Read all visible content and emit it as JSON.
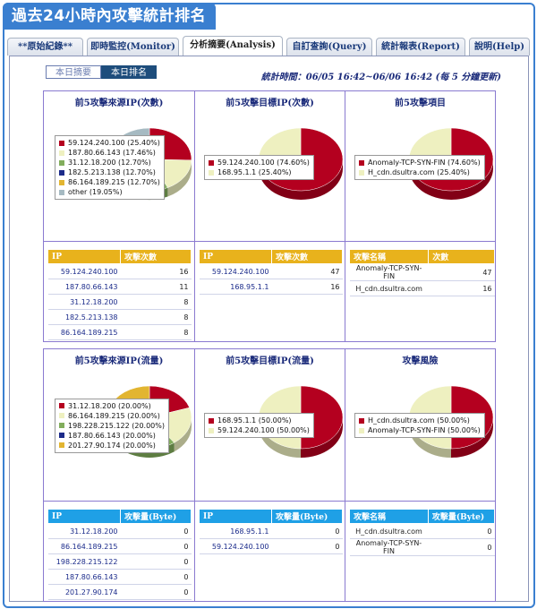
{
  "header": {
    "title": "過去24小時內攻擊統計排名"
  },
  "tabs": [
    {
      "label": "**原始紀錄**"
    },
    {
      "label": "即時監控(Monitor)"
    },
    {
      "label": "分析摘要(Analysis)"
    },
    {
      "label": "自訂查詢(Query)"
    },
    {
      "label": "統計報表(Report)"
    },
    {
      "label": "說明(Help)"
    }
  ],
  "subtabs": [
    {
      "label": "本日摘要"
    },
    {
      "label": "本日排名"
    }
  ],
  "stat_time": "統計時間：06/05 16:42~06/06 16:42 (每 5 分鐘更新)",
  "colors": {
    "red": "#b4001f",
    "cream": "#eef0c0",
    "green": "#82ad5c",
    "navy": "#1c2b8a",
    "gold": "#e2b531",
    "gray": "#a6bac2",
    "tab_blue": "#3a7fd0"
  },
  "chart_data": [
    {
      "type": "pie",
      "title": "前5攻擊來源IP(次數)",
      "labels": [
        "59.124.240.100",
        "187.80.66.143",
        "31.12.18.200",
        "182.5.213.138",
        "86.164.189.215",
        "other"
      ],
      "values": [
        25.4,
        17.46,
        12.7,
        12.7,
        12.7,
        19.05
      ],
      "legend": [
        "59.124.240.100 (25.40%)",
        "187.80.66.143 (17.46%)",
        "31.12.18.200 (12.70%)",
        "182.5.213.138 (12.70%)",
        "86.164.189.215 (12.70%)",
        "other (19.05%)"
      ],
      "colors": [
        "#b4001f",
        "#eef0c0",
        "#82ad5c",
        "#1c2b8a",
        "#e2b531",
        "#a6bac2"
      ]
    },
    {
      "type": "pie",
      "title": "前5攻擊目標IP(次數)",
      "labels": [
        "59.124.240.100",
        "168.95.1.1"
      ],
      "values": [
        74.6,
        25.4
      ],
      "legend": [
        "59.124.240.100 (74.60%)",
        "168.95.1.1 (25.40%)"
      ],
      "colors": [
        "#b4001f",
        "#eef0c0"
      ]
    },
    {
      "type": "pie",
      "title": "前5攻擊項目",
      "labels": [
        "Anomaly-TCP-SYN-FIN",
        "H_cdn.dsultra.com"
      ],
      "values": [
        74.6,
        25.4
      ],
      "legend": [
        "Anomaly-TCP-SYN-FIN (74.60%)",
        "H_cdn.dsultra.com (25.40%)"
      ],
      "colors": [
        "#b4001f",
        "#eef0c0"
      ]
    },
    {
      "type": "pie",
      "title": "前5攻擊來源IP(流量)",
      "labels": [
        "31.12.18.200",
        "86.164.189.215",
        "198.228.215.122",
        "187.80.66.143",
        "201.27.90.174"
      ],
      "values": [
        20.0,
        20.0,
        20.0,
        20.0,
        20.0
      ],
      "legend": [
        "31.12.18.200 (20.00%)",
        "86.164.189.215 (20.00%)",
        "198.228.215.122 (20.00%)",
        "187.80.66.143 (20.00%)",
        "201.27.90.174 (20.00%)"
      ],
      "colors": [
        "#b4001f",
        "#eef0c0",
        "#82ad5c",
        "#1c2b8a",
        "#e2b531"
      ]
    },
    {
      "type": "pie",
      "title": "前5攻擊目標IP(流量)",
      "labels": [
        "168.95.1.1",
        "59.124.240.100"
      ],
      "values": [
        50.0,
        50.0
      ],
      "legend": [
        "168.95.1.1 (50.00%)",
        "59.124.240.100 (50.00%)"
      ],
      "colors": [
        "#b4001f",
        "#eef0c0"
      ]
    },
    {
      "type": "pie",
      "title": "攻擊風險",
      "labels": [
        "H_cdn.dsultra.com",
        "Anomaly-TCP-SYN-FIN"
      ],
      "values": [
        50.0,
        50.0
      ],
      "legend": [
        "H_cdn.dsultra.com (50.00%)",
        "Anomaly-TCP-SYN-FIN (50.00%)"
      ],
      "colors": [
        "#b4001f",
        "#eef0c0"
      ]
    }
  ],
  "tables": [
    {
      "headers": [
        "IP",
        "攻擊次數"
      ],
      "rows": [
        [
          "59.124.240.100",
          "16"
        ],
        [
          "187.80.66.143",
          "11"
        ],
        [
          "31.12.18.200",
          "8"
        ],
        [
          "182.5.213.138",
          "8"
        ],
        [
          "86.164.189.215",
          "8"
        ]
      ]
    },
    {
      "headers": [
        "IP",
        "攻擊次數"
      ],
      "rows": [
        [
          "59.124.240.100",
          "47"
        ],
        [
          "168.95.1.1",
          "16"
        ]
      ]
    },
    {
      "headers": [
        "攻擊名稱",
        "次數"
      ],
      "rows": [
        [
          "Anomaly-TCP-SYN-FIN",
          "47"
        ],
        [
          "H_cdn.dsultra.com",
          "16"
        ]
      ]
    },
    {
      "headers": [
        "IP",
        "攻擊量(Byte)"
      ],
      "rows": [
        [
          "31.12.18.200",
          "0"
        ],
        [
          "86.164.189.215",
          "0"
        ],
        [
          "198.228.215.122",
          "0"
        ],
        [
          "187.80.66.143",
          "0"
        ],
        [
          "201.27.90.174",
          "0"
        ]
      ]
    },
    {
      "headers": [
        "IP",
        "攻擊量(Byte)"
      ],
      "rows": [
        [
          "168.95.1.1",
          "0"
        ],
        [
          "59.124.240.100",
          "0"
        ]
      ]
    },
    {
      "headers": [
        "攻擊名稱",
        "攻擊量(Byte)"
      ],
      "rows": [
        [
          "H_cdn.dsultra.com",
          "0"
        ],
        [
          "Anomaly-TCP-SYN-FIN",
          "0"
        ]
      ]
    }
  ]
}
